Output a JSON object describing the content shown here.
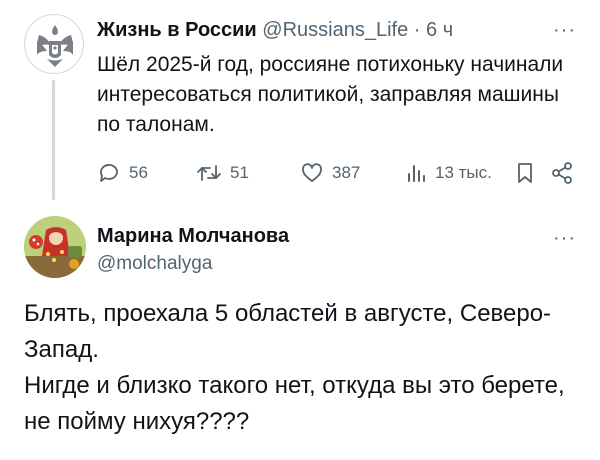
{
  "tweet1": {
    "author_name": "Жизнь в России",
    "handle": "@Russians_Life",
    "separator": "·",
    "time": "6 ч",
    "more": "···",
    "text": "Шёл 2025-й год, россияне потихоньку начинали интересоваться политикой, заправляя машины по талонам.",
    "actions": {
      "replies": "56",
      "retweets": "51",
      "likes": "387",
      "views": "13 тыс."
    },
    "avatar_icon": "coat-of-arms-icon"
  },
  "tweet2": {
    "author_name": "Марина Молчанова",
    "handle": "@molchalyga",
    "more": "···",
    "text_line1": "Блять, проехала 5 областей в августе, Северо-Запад.",
    "text_line2": "Нигде и близко такого нет, откуда вы это берете, не пойму нихуя????",
    "avatar_icon": "illustrated-avatar-icon"
  },
  "colors": {
    "text": "#0f1419",
    "muted": "#536471",
    "thread_line": "#cfd9de"
  }
}
